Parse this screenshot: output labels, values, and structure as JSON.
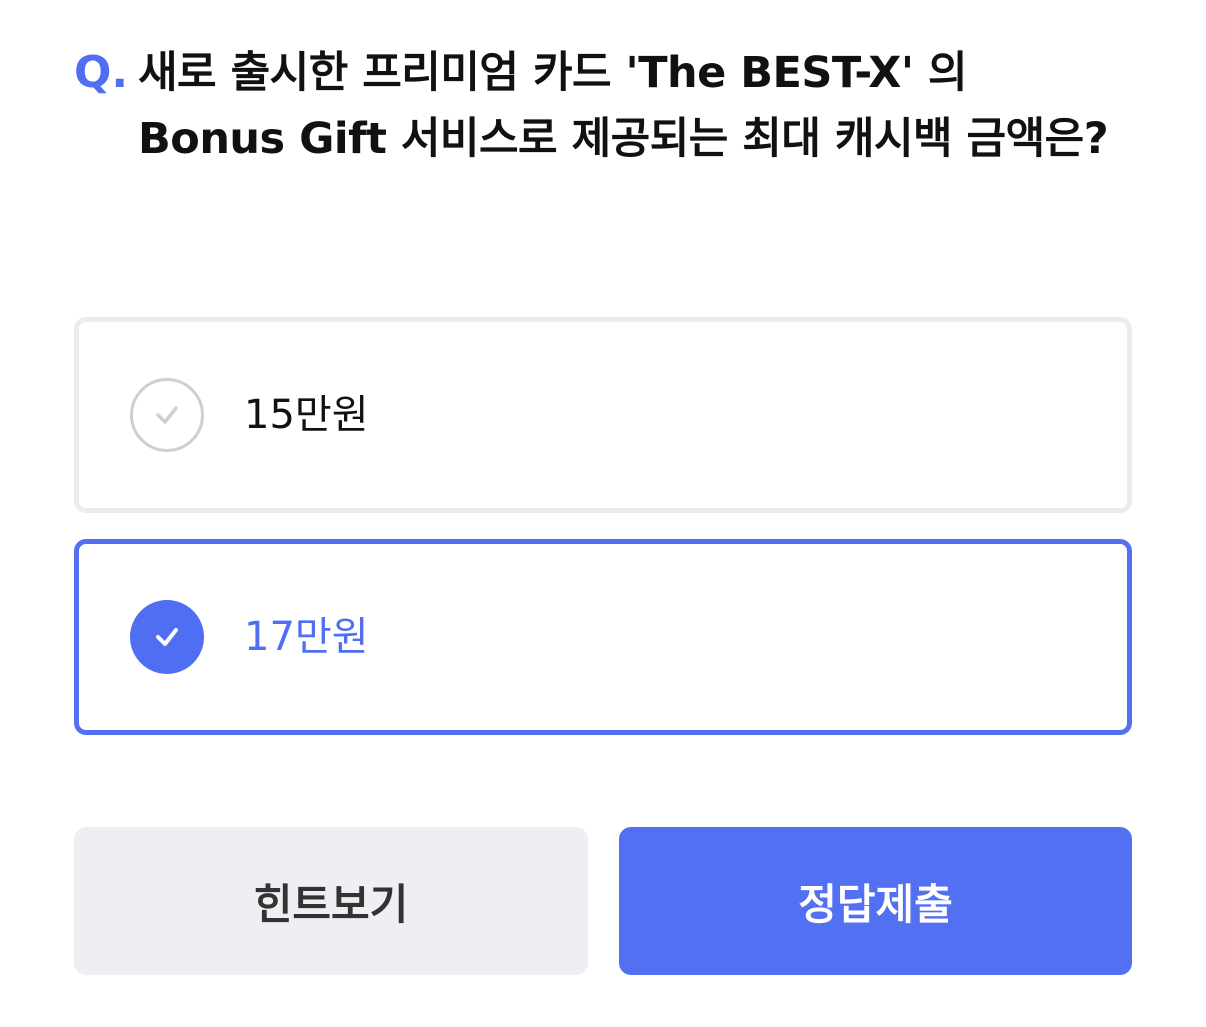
{
  "question": {
    "prefix": "Q.",
    "text": "새로 출시한 프리미엄 카드 'The BEST-X' 의 Bonus Gift 서비스로 제공되는 최대 캐시백 금액은?"
  },
  "options": [
    {
      "label": "15만원",
      "selected": false,
      "icon": "check-icon"
    },
    {
      "label": "17만원",
      "selected": true,
      "icon": "check-icon"
    }
  ],
  "buttons": {
    "hint_label": "힌트보기",
    "submit_label": "정답제출"
  },
  "colors": {
    "accent": "#4f6ef2",
    "selected_border": "#5470f0",
    "unselected_border": "#ececee",
    "hint_bg": "#eeeff2",
    "submit_bg": "#5470f2"
  }
}
